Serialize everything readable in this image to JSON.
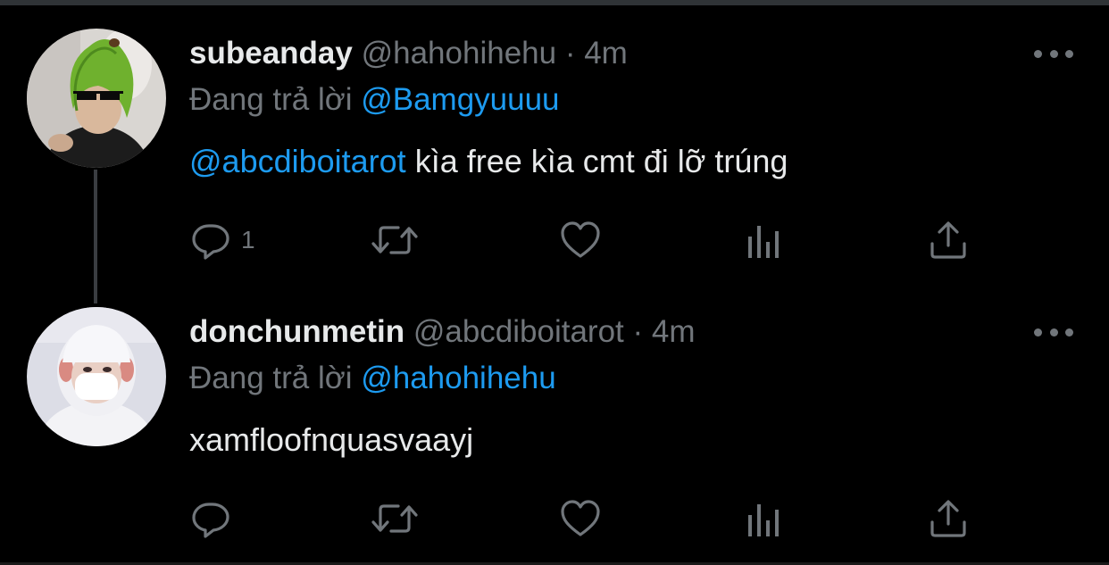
{
  "colors": {
    "background": "#000000",
    "text": "#e7e9ea",
    "muted": "#71767b",
    "link": "#1d9bf0",
    "thread_line": "#3a3d41"
  },
  "tweets": [
    {
      "display_name": "subeanday",
      "handle": "@hahohihehu",
      "separator": "·",
      "time": "4m",
      "replying_prefix": "Đang trả lời",
      "replying_to": "@Bamgyuuuu",
      "mention": "@abcdiboitarot",
      "text": " kìa free kìa cmt đi lỡ trúng",
      "reply_count": "1",
      "avatar_icon": "avocado-costume-avatar"
    },
    {
      "display_name": "donchunmetin",
      "handle": "@abcdiboitarot",
      "separator": "·",
      "time": "4m",
      "replying_prefix": "Đang trả lời",
      "replying_to": "@hahohihehu",
      "mention": "",
      "text": "xamfloofnquasvaayj",
      "reply_count": "",
      "avatar_icon": "white-hooded-masked-avatar"
    }
  ],
  "action_icons": [
    "reply-icon",
    "retweet-icon",
    "like-icon",
    "analytics-icon",
    "share-icon"
  ],
  "more_icon": "more-options-icon"
}
